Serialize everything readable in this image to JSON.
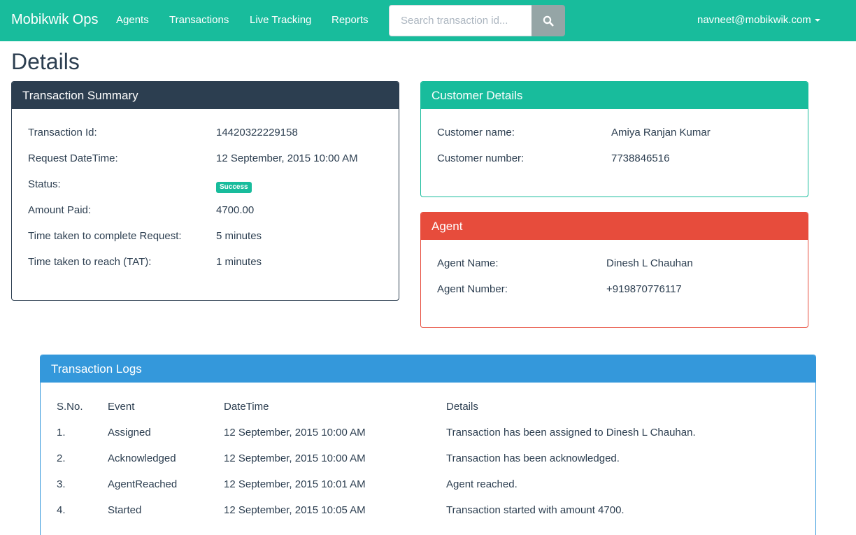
{
  "nav": {
    "brand": "Mobikwik Ops",
    "links": [
      "Agents",
      "Transactions",
      "Live Tracking",
      "Reports"
    ],
    "search_placeholder": "Search transaction id...",
    "user": "navneet@mobikwik.com"
  },
  "page_title": "Details",
  "summary": {
    "heading": "Transaction Summary",
    "rows": [
      {
        "label": "Transaction Id:",
        "value": "14420322229158"
      },
      {
        "label": "Request DateTime:",
        "value": "12 September, 2015 10:00 AM"
      },
      {
        "label": "Status:",
        "value": "Success"
      },
      {
        "label": "Amount Paid:",
        "value": "4700.00"
      },
      {
        "label": "Time taken to complete Request:",
        "value": "5 minutes"
      },
      {
        "label": "Time taken to reach (TAT):",
        "value": "1 minutes"
      }
    ]
  },
  "customer": {
    "heading": "Customer Details",
    "rows": [
      {
        "label": "Customer name:",
        "value": "Amiya Ranjan Kumar"
      },
      {
        "label": "Customer number:",
        "value": "7738846516"
      }
    ]
  },
  "agent": {
    "heading": "Agent",
    "rows": [
      {
        "label": "Agent Name:",
        "value": "Dinesh L Chauhan"
      },
      {
        "label": "Agent Number:",
        "value": "+919870776117"
      }
    ]
  },
  "logs": {
    "heading": "Transaction Logs",
    "columns": [
      "S.No.",
      "Event",
      "DateTime",
      "Details"
    ],
    "rows": [
      [
        "1.",
        "Assigned",
        "12 September, 2015 10:00 AM",
        "Transaction has been assigned to Dinesh L Chauhan."
      ],
      [
        "2.",
        "Acknowledged",
        "12 September, 2015 10:00 AM",
        "Transaction has been acknowledged."
      ],
      [
        "3.",
        "AgentReached",
        "12 September, 2015 10:01 AM",
        "Agent reached."
      ],
      [
        "4.",
        "Started",
        "12 September, 2015 10:05 AM",
        "Transaction started with amount 4700."
      ]
    ]
  },
  "colors": {
    "navbar": "#18bc9c",
    "summary": "#2c3e50",
    "customer": "#18bc9c",
    "agent": "#e74c3c",
    "logs": "#3498db",
    "success_badge": "#18bc9c"
  }
}
